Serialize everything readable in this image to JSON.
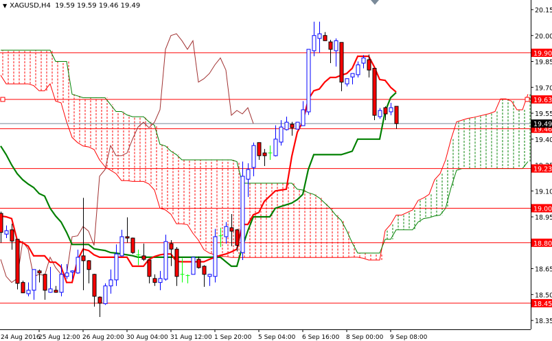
{
  "header": {
    "menu_icon": "triangle-down-icon",
    "symbol": "XAGUSD,H4",
    "ohlc": "19.59 19.59 19.46 19.49"
  },
  "colors": {
    "bull": "#0000ff",
    "bear_fill": "#ff0000",
    "bear_wick": "#000000",
    "doji": "#00ff00",
    "tenkan": "#ff0000",
    "kijun": "#008000",
    "chikou": "#a03030",
    "span_a": "#ff0000",
    "span_b": "#008000",
    "level_line": "#ff0000",
    "bid_line": "#778899"
  },
  "chart_data": {
    "type": "candlestick",
    "symbol": "XAGUSD",
    "timeframe": "H4",
    "ylim": [
      18.35,
      20.15
    ],
    "y_ticks": [
      "20.15",
      "20.00",
      "19.85",
      "19.70",
      "19.55",
      "19.40",
      "19.25",
      "19.10",
      "18.95",
      "18.80",
      "18.65",
      "18.50",
      "18.35"
    ],
    "x_ticks": [
      {
        "bar": 0,
        "label": "24 Aug 2016"
      },
      {
        "bar": 8,
        "label": "25 Aug 12:00"
      },
      {
        "bar": 16,
        "label": "26 Aug 20:00"
      },
      {
        "bar": 24,
        "label": "30 Aug 04:00"
      },
      {
        "bar": 32,
        "label": "31 Aug 12:00"
      },
      {
        "bar": 40,
        "label": "1 Sep 20:00"
      },
      {
        "bar": 48,
        "label": "5 Sep 04:00"
      },
      {
        "bar": 56,
        "label": "6 Sep 16:00"
      },
      {
        "bar": 64,
        "label": "8 Sep 00:00"
      },
      {
        "bar": 72,
        "label": "9 Sep 08:00"
      }
    ],
    "levels": [
      "19.90",
      "19.63",
      "19.46",
      "19.23",
      "19.00",
      "18.80",
      "18.45"
    ],
    "bid": "19.49",
    "open": [
      18.97,
      18.85,
      18.875,
      18.82,
      18.57,
      18.505,
      18.525,
      18.637,
      18.617,
      18.513,
      18.525,
      18.513,
      18.605,
      18.63,
      18.625,
      18.724,
      18.696,
      18.617,
      18.485,
      18.447,
      18.55,
      18.585,
      18.724,
      18.835,
      18.827,
      18.73,
      18.724,
      18.7,
      18.593,
      18.57,
      18.589,
      18.795,
      18.763,
      18.617,
      18.61,
      18.617,
      18.704,
      18.664,
      18.605,
      18.605,
      18.84,
      18.835,
      18.887,
      18.875,
      18.743,
      19.168,
      19.236,
      19.38,
      19.32,
      19.32,
      19.304,
      19.383,
      19.455,
      19.486,
      19.458,
      19.478,
      19.558,
      19.912,
      19.983,
      20.0,
      19.963,
      19.912,
      19.96,
      19.72,
      19.76,
      19.773,
      19.84,
      19.86,
      19.81,
      19.53,
      19.582,
      19.558,
      19.59
    ],
    "high": [
      18.98,
      18.9,
      18.91,
      18.82,
      18.58,
      18.57,
      18.645,
      18.645,
      18.62,
      18.66,
      18.55,
      18.676,
      18.676,
      18.64,
      18.76,
      19.06,
      18.7,
      18.62,
      18.49,
      18.565,
      18.645,
      18.79,
      18.875,
      18.947,
      18.83,
      18.76,
      18.795,
      18.7,
      18.617,
      18.637,
      18.847,
      18.815,
      18.775,
      18.71,
      18.617,
      18.716,
      18.72,
      18.67,
      18.62,
      18.88,
      18.887,
      18.92,
      18.966,
      18.88,
      19.27,
      19.26,
      19.38,
      19.38,
      19.343,
      19.363,
      19.48,
      19.51,
      19.53,
      19.5,
      19.5,
      19.62,
      19.92,
      20.08,
      20.08,
      20.02,
      19.975,
      19.983,
      19.96,
      19.75,
      19.78,
      19.85,
      19.887,
      19.89,
      19.81,
      19.58,
      19.59,
      19.61,
      19.59
    ],
    "low": [
      18.8,
      18.827,
      18.76,
      18.53,
      18.51,
      18.49,
      18.47,
      18.57,
      18.47,
      18.51,
      18.51,
      18.49,
      18.59,
      18.59,
      18.62,
      18.525,
      18.565,
      18.43,
      18.37,
      18.44,
      18.505,
      18.55,
      18.72,
      18.8,
      18.735,
      18.67,
      18.695,
      18.565,
      18.55,
      18.525,
      18.58,
      18.665,
      18.55,
      18.57,
      18.565,
      18.617,
      18.65,
      18.545,
      18.55,
      18.57,
      18.775,
      18.795,
      18.78,
      18.75,
      18.7,
      19.065,
      19.185,
      19.28,
      19.244,
      19.28,
      19.3,
      19.363,
      19.45,
      19.42,
      19.458,
      19.478,
      19.54,
      19.88,
      19.9,
      19.97,
      19.84,
      19.82,
      19.677,
      19.705,
      19.717,
      19.757,
      19.81,
      19.757,
      19.51,
      19.518,
      19.51,
      19.538,
      19.46
    ],
    "close": [
      18.86,
      18.87,
      18.81,
      18.565,
      18.51,
      18.525,
      18.645,
      18.625,
      18.525,
      18.533,
      18.513,
      18.617,
      18.625,
      18.637,
      18.716,
      18.696,
      18.645,
      18.49,
      18.45,
      18.55,
      18.585,
      18.735,
      18.835,
      18.827,
      18.743,
      18.73,
      18.704,
      18.605,
      18.57,
      18.593,
      18.807,
      18.763,
      18.605,
      18.617,
      18.61,
      18.716,
      18.656,
      18.617,
      18.617,
      18.835,
      18.84,
      18.894,
      18.867,
      18.785,
      19.185,
      19.224,
      19.363,
      19.304,
      19.304,
      19.32,
      19.4,
      19.47,
      19.498,
      19.466,
      19.498,
      19.57,
      19.92,
      20.0,
      20.01,
      19.97,
      19.92,
      19.97,
      19.73,
      19.75,
      19.78,
      19.83,
      19.87,
      19.8,
      19.538,
      19.566,
      19.546,
      19.582,
      19.49
    ],
    "tenkan": [
      18.955,
      18.95,
      18.94,
      18.815,
      18.8,
      18.78,
      18.724,
      18.724,
      18.724,
      18.687,
      18.687,
      18.66,
      18.57,
      18.57,
      18.7,
      18.763,
      18.755,
      18.73,
      18.716,
      18.716,
      18.716,
      18.716,
      18.716,
      18.716,
      18.664,
      18.664,
      18.664,
      18.704,
      18.72,
      18.73,
      18.735,
      18.735,
      18.692,
      18.69,
      18.69,
      18.69,
      18.69,
      18.69,
      18.704,
      18.716,
      18.727,
      18.735,
      18.747,
      18.763,
      18.906,
      18.906,
      18.962,
      18.975,
      19.04,
      19.07,
      19.1,
      19.105,
      19.11,
      19.3,
      19.44,
      19.5,
      19.63,
      19.68,
      19.69,
      19.73,
      19.757,
      19.757,
      19.77,
      19.78,
      19.81,
      19.88,
      19.88,
      19.88,
      19.82,
      19.745,
      19.74,
      19.7,
      19.673
    ],
    "kijun": [
      19.36,
      19.31,
      19.25,
      19.2,
      19.165,
      19.14,
      19.12,
      19.085,
      19.07,
      19.0,
      18.955,
      18.92,
      18.86,
      18.79,
      18.79,
      18.79,
      18.79,
      18.765,
      18.76,
      18.755,
      18.743,
      18.74,
      18.735,
      18.73,
      18.725,
      18.716,
      18.716,
      18.716,
      18.716,
      18.716,
      18.716,
      18.716,
      18.716,
      18.716,
      18.716,
      18.716,
      18.716,
      18.716,
      18.716,
      18.716,
      18.716,
      18.69,
      18.664,
      18.664,
      18.775,
      18.87,
      18.95,
      18.95,
      18.95,
      18.95,
      19.0,
      19.01,
      19.02,
      19.03,
      19.05,
      19.08,
      19.224,
      19.31,
      19.31,
      19.31,
      19.31,
      19.31,
      19.31,
      19.32,
      19.33,
      19.4,
      19.4,
      19.4,
      19.4,
      19.4,
      19.56,
      19.64,
      19.67
    ],
    "chikou_shift": 26,
    "senkou_a": [
      19.77,
      19.72,
      19.72,
      19.72,
      19.72,
      19.72,
      19.71,
      19.68,
      19.68,
      19.72,
      19.62,
      19.61,
      19.5,
      19.41,
      19.38,
      19.36,
      19.355,
      19.34,
      19.28,
      19.24,
      19.22,
      19.2,
      19.16,
      19.16,
      19.155,
      19.155,
      19.155,
      19.14,
      19.105,
      19.0,
      18.99,
      18.965,
      18.91,
      18.91,
      18.905,
      18.855,
      18.815,
      18.76,
      18.74,
      18.73,
      18.72,
      18.72,
      18.715,
      18.715,
      18.715,
      18.715,
      18.715,
      18.715,
      18.715,
      18.715,
      18.715,
      18.715,
      18.715,
      18.715,
      18.715,
      18.715,
      18.715,
      18.715,
      18.715,
      18.715,
      18.715,
      18.715,
      18.715,
      18.715,
      18.716,
      18.716,
      18.71,
      18.7,
      18.7,
      18.7,
      18.87,
      18.906,
      18.96,
      18.96,
      18.975,
      18.99,
      19.045,
      19.06,
      19.08,
      19.165,
      19.2,
      19.28,
      19.4,
      19.5,
      19.51,
      19.52,
      19.525,
      19.533,
      19.54,
      19.548,
      19.56,
      19.633,
      19.633,
      19.62,
      19.57,
      19.57,
      19.66
    ],
    "senkou_b": [
      19.915,
      19.915,
      19.915,
      19.915,
      19.915,
      19.915,
      19.915,
      19.915,
      19.915,
      19.915,
      19.85,
      19.85,
      19.85,
      19.66,
      19.65,
      19.64,
      19.64,
      19.64,
      19.64,
      19.64,
      19.6,
      19.56,
      19.56,
      19.54,
      19.53,
      19.53,
      19.53,
      19.5,
      19.48,
      19.37,
      19.36,
      19.33,
      19.31,
      19.28,
      19.28,
      19.28,
      19.28,
      19.28,
      19.28,
      19.28,
      19.28,
      19.28,
      19.28,
      19.27,
      19.145,
      19.145,
      19.145,
      19.145,
      19.145,
      19.145,
      19.145,
      19.145,
      19.145,
      19.145,
      19.11,
      19.105,
      19.09,
      19.08,
      19.06,
      19.03,
      19.0,
      18.96,
      18.93,
      18.87,
      18.8,
      18.74,
      18.74,
      18.74,
      18.74,
      18.74,
      18.82,
      18.82,
      18.875,
      18.875,
      18.875,
      18.875,
      18.92,
      18.94,
      18.945,
      18.955,
      18.96,
      19.0,
      19.12,
      19.22,
      19.23,
      19.23,
      19.23,
      19.23,
      19.23,
      19.23,
      19.23,
      19.23,
      19.23,
      19.23,
      19.23,
      19.23,
      19.27
    ]
  }
}
